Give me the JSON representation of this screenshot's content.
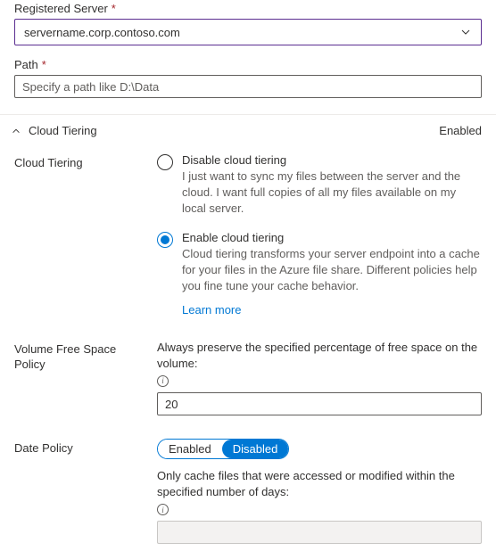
{
  "registeredServer": {
    "label": "Registered Server",
    "value": "servername.corp.contoso.com"
  },
  "path": {
    "label": "Path",
    "placeholder": "Specify a path like D:\\Data"
  },
  "cloudTieringSection": {
    "title": "Cloud Tiering",
    "status": "Enabled",
    "fieldLabel": "Cloud Tiering",
    "disableOption": {
      "title": "Disable cloud tiering",
      "desc": "I just want to sync my files between the server and the cloud. I want full copies of all my files available on my local server."
    },
    "enableOption": {
      "title": "Enable cloud tiering",
      "desc": "Cloud tiering transforms your server endpoint into a cache for your files in the Azure file share. Different policies help you fine tune your cache behavior."
    },
    "learnMore": "Learn more"
  },
  "volumePolicy": {
    "label": "Volume Free Space Policy",
    "desc": "Always preserve the specified percentage of free space on the volume:",
    "value": "20"
  },
  "datePolicy": {
    "label": "Date Policy",
    "toggle": {
      "enabled": "Enabled",
      "disabled": "Disabled"
    },
    "desc": "Only cache files that were accessed or modified within the specified number of days:"
  }
}
